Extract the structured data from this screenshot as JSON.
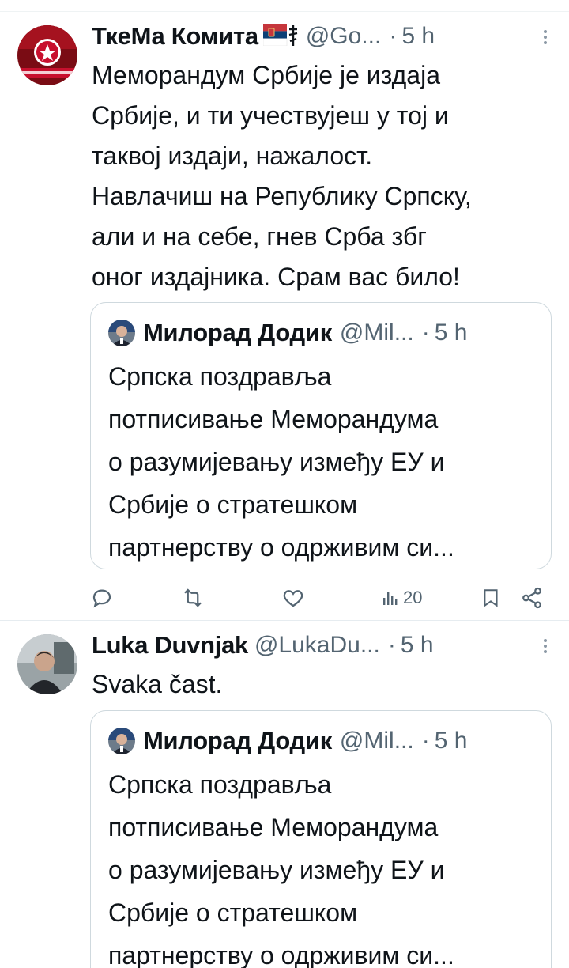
{
  "tweets": [
    {
      "author_name": "ТкеМа Комита",
      "handle": "@Go...",
      "dot": "·",
      "time": "5 h",
      "text": "Меморандум Србије је издаја\nСрбије, и ти учествујеш у тој и\nтаквој издаји, нажалост.\nНавлачиш на Републику Српску,\nали и на себе, гнев Срба збг\nоног издајника. Срам вас било!",
      "quote": {
        "author_name": "Милорад Додик",
        "handle": "@Mil...",
        "dot": "·",
        "time": "5 h",
        "text": "Српска поздравља\nпотписивање Меморандума\nо разумијевању између ЕУ и\nСрбије о стратешком\nпартнерству о одрживим си..."
      },
      "actions": {
        "views": "20"
      }
    },
    {
      "author_name": "Luka Duvnjak",
      "handle": "@LukaDu...",
      "dot": "·",
      "time": "5 h",
      "text": "Svaka čast.",
      "quote": {
        "author_name": "Милорад Додик",
        "handle": "@Mil...",
        "dot": "·",
        "time": "5 h",
        "text": "Српска поздравља\nпотписивање Меморандума\nо разумијевању између ЕУ и\nСрбије о стратешком\nпартнерству о одрживим си..."
      }
    }
  ],
  "icons": {
    "reply": "reply-icon",
    "retweet": "retweet-icon",
    "like": "like-icon",
    "views": "views-icon",
    "bookmark": "bookmark-icon",
    "share": "share-icon",
    "more": "more-icon",
    "flags": "serbian-flag-icon"
  },
  "colors": {
    "text": "#0f1419",
    "secondary": "#536471",
    "border": "#cfd9de",
    "avatar_red": "#c8102e"
  }
}
